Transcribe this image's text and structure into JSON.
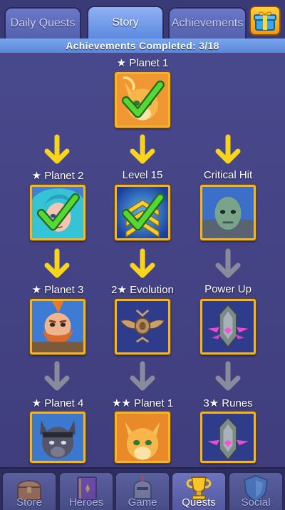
{
  "tabs": [
    {
      "label": "Daily Quests",
      "active": false
    },
    {
      "label": "Story",
      "active": true
    },
    {
      "label": "Achievements",
      "active": false
    }
  ],
  "gift_icon": "gift-box-icon",
  "achievements_completed": "Achievements Completed: 3/18",
  "nodes": {
    "planet1_top": {
      "label": "★ Planet 1",
      "completed": true,
      "portrait": "fox-hero"
    },
    "planet2": {
      "label": "★ Planet 2",
      "completed": true,
      "portrait": "blue-hair-heroine"
    },
    "level15": {
      "label": "Level 15",
      "completed": true,
      "portrait": "level-chevrons"
    },
    "critical_hit": {
      "label": "Critical Hit",
      "completed": false,
      "portrait": "green-alien"
    },
    "planet3": {
      "label": "★ Planet 3",
      "completed": false,
      "portrait": "bearded-warrior"
    },
    "evolution2": {
      "label": "2★ Evolution",
      "completed": false,
      "portrait": "winged-badge"
    },
    "power_up": {
      "label": "Power Up",
      "completed": false,
      "portrait": "rune-gem"
    },
    "planet4": {
      "label": "★ Planet 4",
      "completed": false,
      "portrait": "panther-hero"
    },
    "planet1_two_star": {
      "label": "★★ Planet 1",
      "completed": false,
      "portrait": "fox-hero"
    },
    "runes3": {
      "label": "3★ Runes",
      "completed": false,
      "portrait": "rune-gem"
    }
  },
  "arrow_colors": {
    "unlocked": "#f7d51d",
    "locked": "#8a8a9e"
  },
  "bottom_nav": [
    {
      "label": "Store",
      "active": false,
      "icon": "treasure-chest-icon"
    },
    {
      "label": "Heroes",
      "active": false,
      "icon": "spellbook-icon"
    },
    {
      "label": "Game",
      "active": false,
      "icon": "knight-helmet-icon"
    },
    {
      "label": "Quests",
      "active": true,
      "icon": "trophy-icon"
    },
    {
      "label": "Social",
      "active": false,
      "icon": "shield-icon"
    }
  ]
}
